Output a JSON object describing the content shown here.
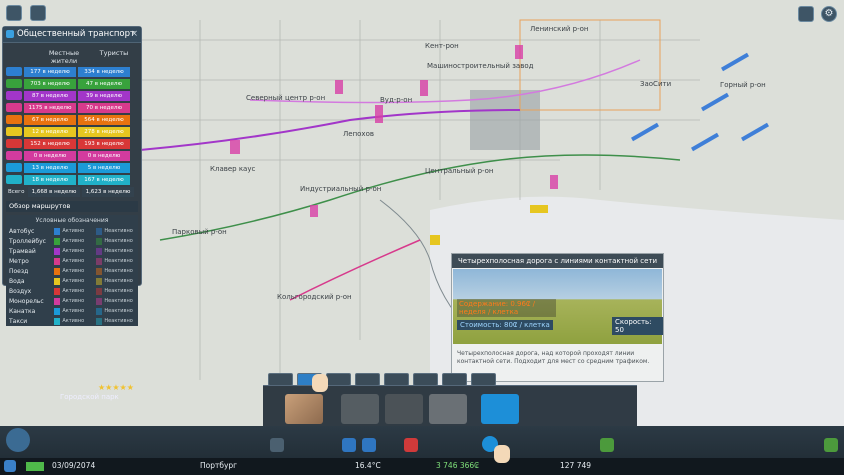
{
  "panel": {
    "title": "Общественный транспорт",
    "close": "×",
    "columns": [
      "Местные жители",
      "Туристы"
    ],
    "rows": [
      {
        "color": "#2d7fd0",
        "residents": "177 в неделю",
        "tourists": "334 в неделю"
      },
      {
        "color": "#38a23c",
        "residents": "703 в неделю",
        "tourists": "47 в неделю"
      },
      {
        "color": "#a236c9",
        "residents": "87 в неделю",
        "tourists": "39 в неделю"
      },
      {
        "color": "#d73a8c",
        "residents": "1175 в неделю",
        "tourists": "70 в неделю"
      },
      {
        "color": "#e8720f",
        "residents": "67 в неделю",
        "tourists": "564 в неделю"
      },
      {
        "color": "#e6c620",
        "residents": "12 в неделю",
        "tourists": "278 в неделю"
      },
      {
        "color": "#d83737",
        "residents": "152 в неделю",
        "tourists": "193 в неделю"
      },
      {
        "color": "#d33b9e",
        "residents": "0 в неделю",
        "tourists": "0 в неделю"
      },
      {
        "color": "#1b9ad8",
        "residents": "13 в неделю",
        "tourists": "5 в неделю"
      },
      {
        "color": "#21b1c8",
        "residents": "18 в неделю",
        "tourists": "167 в неделю"
      }
    ],
    "total_label": "Всего",
    "total_residents": "1,668 в неделю",
    "total_tourists": "1,623 в неделю",
    "overview_label": "Обзор маршрутов",
    "legend_title": "Условные обозначения",
    "legend": [
      {
        "name": "Автобус",
        "color": "#2d7fd0"
      },
      {
        "name": "Троллейбус",
        "color": "#38a23c"
      },
      {
        "name": "Трамвай",
        "color": "#a236c9"
      },
      {
        "name": "Метро",
        "color": "#d73a8c"
      },
      {
        "name": "Поезд",
        "color": "#e8720f"
      },
      {
        "name": "Вода",
        "color": "#e6c620"
      },
      {
        "name": "Воздух",
        "color": "#d83737"
      },
      {
        "name": "Монорельс",
        "color": "#d33b9e"
      },
      {
        "name": "Канатка",
        "color": "#1b9ad8"
      },
      {
        "name": "Такси",
        "color": "#21b1c8"
      }
    ],
    "active": "Активно",
    "inactive": "Неактивно"
  },
  "map_labels": {
    "kent": "Кент-рон",
    "machine": "Машиностроительный завод",
    "leninsky": "Ленинский р-он",
    "north": "Северный центр р-он",
    "vud": "Вуд-р-он",
    "lepokhov": "Лепохов",
    "klaver": "Клавер каус",
    "industrial": "Индустриальный р-он",
    "central": "Центральный р-он",
    "park": "Парковый р-он",
    "kolgorod": "Кольгородский р-он",
    "gorod": "Городской парк",
    "gorny": "Горный р-он",
    "zaosity": "ЗаоСити"
  },
  "tooltip": {
    "title": "Четырехполосная дорога с линиями контактной сети",
    "maintenance": "Содержание: 0.96₢ / неделя / клетка",
    "cost": "Стоимость: 80₢ / клетка",
    "speed": "Скорость: 50",
    "description": "Четырехполосная дорога, над которой проходят линии контактной сети. Подходит для мест со средним трафиком."
  },
  "status": {
    "date": "03/09/2074",
    "city": "Портбург",
    "temperature": "16.4°C",
    "money": "3 746 366₢",
    "population": "127 749",
    "stars": "★★★★★"
  }
}
